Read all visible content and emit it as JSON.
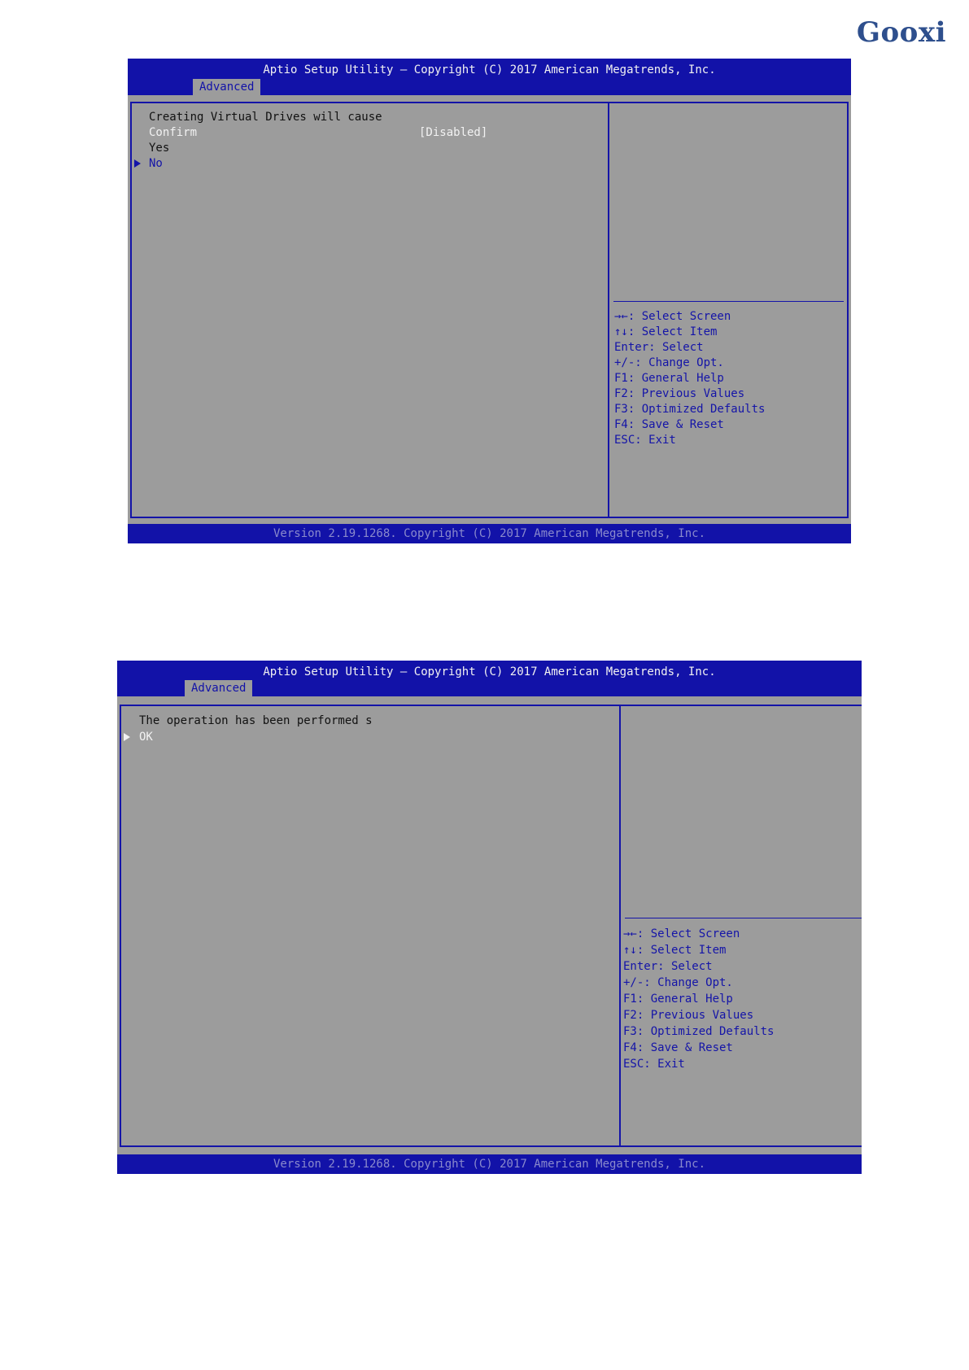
{
  "brand": {
    "logo_text": "Gooxi"
  },
  "screen1": {
    "title": "Aptio Setup Utility – Copyright (C) 2017 American Megatrends, Inc.",
    "tab": "Advanced",
    "message": "Creating Virtual Drives will cause",
    "confirm_label": "Confirm",
    "confirm_value": "[Disabled]",
    "option_yes": "Yes",
    "option_no": "No",
    "help": [
      "→←: Select Screen",
      "↑↓: Select Item",
      "Enter: Select",
      "+/-: Change Opt.",
      "F1: General Help",
      "F2: Previous Values",
      "F3: Optimized Defaults",
      "F4: Save & Reset",
      "ESC: Exit"
    ],
    "footer": "Version 2.19.1268. Copyright (C) 2017 American Megatrends, Inc."
  },
  "screen2": {
    "title": "Aptio Setup Utility – Copyright (C) 2017 American Megatrends, Inc.",
    "tab": "Advanced",
    "message": "The operation has been performed s",
    "option_ok": "OK",
    "help": [
      "→←: Select Screen",
      "↑↓: Select Item",
      "Enter: Select",
      "+/-: Change Opt.",
      "F1: General Help",
      "F2: Previous Values",
      "F3: Optimized Defaults",
      "F4: Save & Reset",
      "ESC: Exit"
    ],
    "footer": "Version 2.19.1268. Copyright (C) 2017 American Megatrends, Inc."
  }
}
